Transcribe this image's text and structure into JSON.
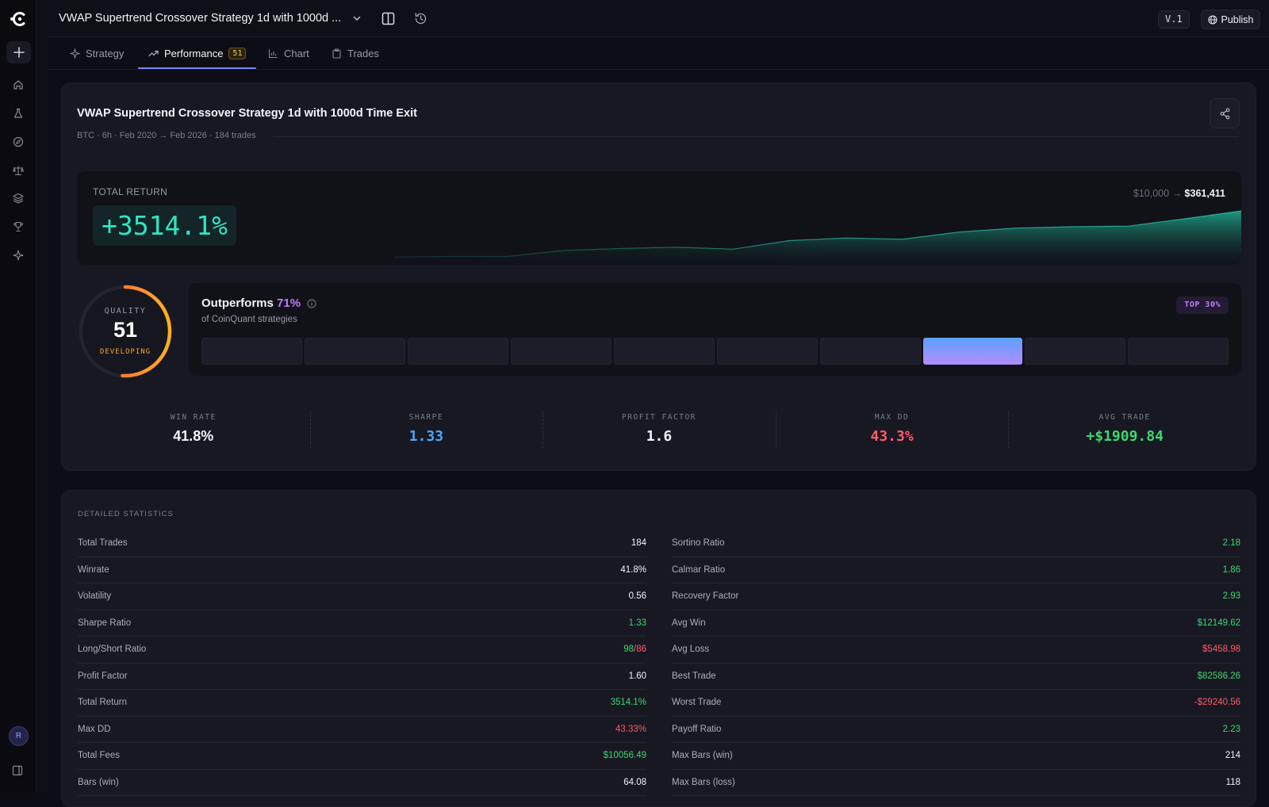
{
  "header": {
    "title": "VWAP Supertrend Crossover Strategy 1d with 1000d ...",
    "version": "V.1",
    "publish_label": "Publish"
  },
  "tabs": [
    {
      "label": "Strategy",
      "icon": "sparkle-icon"
    },
    {
      "label": "Performance",
      "icon": "trend-up-icon",
      "badge": "51"
    },
    {
      "label": "Chart",
      "icon": "chart-icon"
    },
    {
      "label": "Trades",
      "icon": "clipboard-icon"
    }
  ],
  "sidebar": {
    "avatar_initial": "R",
    "icons": [
      "home-icon",
      "flask-icon",
      "compass-icon",
      "scale-icon",
      "layers-icon",
      "trophy-icon",
      "sparkle-icon"
    ]
  },
  "summary": {
    "title": "VWAP Supertrend Crossover Strategy 1d with 1000d Time Exit",
    "meta": "BTC · 6h · Feb 2020 → Feb 2026 · 184 trades"
  },
  "total_return": {
    "label": "TOTAL RETURN",
    "value": "+3514.1%",
    "start": "$10,000",
    "arrow": "→",
    "end": "$361,411",
    "equity_curve": [
      0.02,
      0.03,
      0.03,
      0.12,
      0.15,
      0.17,
      0.14,
      0.27,
      0.31,
      0.29,
      0.4,
      0.46,
      0.48,
      0.49,
      0.6,
      0.72
    ],
    "accent": "#2ee6c4"
  },
  "quality": {
    "label": "QUALITY",
    "score": "51",
    "fraction": 0.51,
    "status": "DEVELOPING"
  },
  "outperforms": {
    "title": "Outperforms",
    "percent": "71%",
    "subtitle": "of CoinQuant strategies",
    "badge": "TOP 30%",
    "bucket_count": 10,
    "highlight_bucket": 8
  },
  "metrics": [
    {
      "label": "WIN RATE",
      "value": "41.8%",
      "tone": "white"
    },
    {
      "label": "SHARPE",
      "value": "1.33",
      "tone": "blue"
    },
    {
      "label": "PROFIT FACTOR",
      "value": "1.6",
      "tone": "white"
    },
    {
      "label": "MAX DD",
      "value": "43.3%",
      "tone": "neg"
    },
    {
      "label": "AVG TRADE",
      "value": "+$1909.84",
      "tone": "pos"
    }
  ],
  "detailed": {
    "title": "DETAILED STATISTICS",
    "left": [
      {
        "k": "Total Trades",
        "v": "184",
        "tone": "white"
      },
      {
        "k": "Winrate",
        "v": "41.8%",
        "tone": "white"
      },
      {
        "k": "Volatility",
        "v": "0.56",
        "tone": "white"
      },
      {
        "k": "Sharpe Ratio",
        "v": "1.33",
        "tone": "pos"
      },
      {
        "k": "Long/Short Ratio",
        "v": "98",
        "v2": "/86",
        "tone": "pos"
      },
      {
        "k": "Profit Factor",
        "v": "1.60",
        "tone": "white"
      },
      {
        "k": "Total Return",
        "v": "3514.1%",
        "tone": "pos"
      },
      {
        "k": "Max DD",
        "v": "43.33%",
        "tone": "neg"
      },
      {
        "k": "Total Fees",
        "v": "$10056.49",
        "tone": "pos"
      },
      {
        "k": "Bars (win)",
        "v": "64.08",
        "tone": "white"
      }
    ],
    "right": [
      {
        "k": "Sortino Ratio",
        "v": "2.18",
        "tone": "pos"
      },
      {
        "k": "Calmar Ratio",
        "v": "1.86",
        "tone": "pos"
      },
      {
        "k": "Recovery Factor",
        "v": "2.93",
        "tone": "pos"
      },
      {
        "k": "Avg Win",
        "v": "$12149.62",
        "tone": "pos"
      },
      {
        "k": "Avg Loss",
        "v": "$5458.98",
        "tone": "neg"
      },
      {
        "k": "Best Trade",
        "v": "$82586.26",
        "tone": "pos"
      },
      {
        "k": "Worst Trade",
        "v": "-$29240.56",
        "tone": "neg"
      },
      {
        "k": "Payoff Ratio",
        "v": "2.23",
        "tone": "pos"
      },
      {
        "k": "Max Bars (win)",
        "v": "214",
        "tone": "white"
      },
      {
        "k": "Max Bars (loss)",
        "v": "118",
        "tone": "white"
      }
    ]
  }
}
